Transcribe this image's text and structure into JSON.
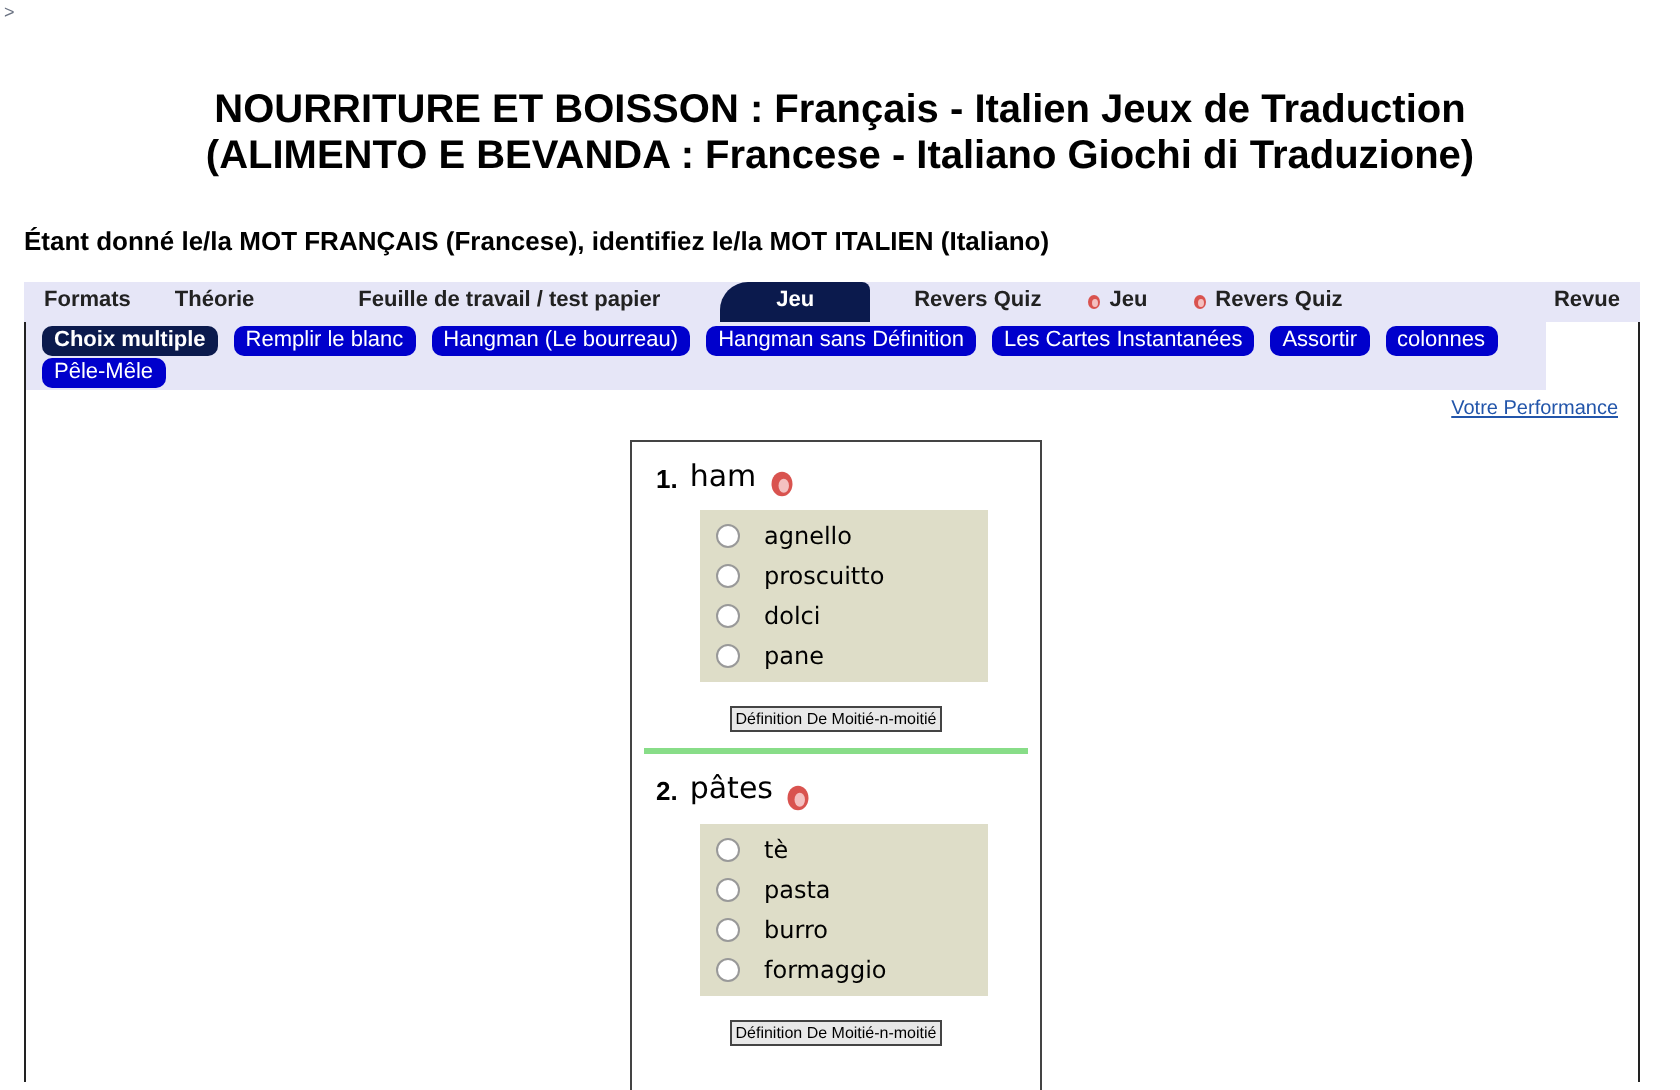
{
  "breadcrumb": ">",
  "title": [
    "NOURRITURE ET BOISSON : Français - Italien Jeux de Traduction",
    "(ALIMENTO E BEVANDA : Francese - Italiano Giochi di Traduzione)"
  ],
  "instruction": "Étant donné le/la MOT FRANÇAIS (Francese), identifiez le/la MOT ITALIEN (Italiano)",
  "tabs": [
    {
      "label": "Formats",
      "selected": false,
      "icon": false
    },
    {
      "label": "Théorie",
      "selected": false,
      "icon": false
    },
    {
      "label": "Feuille de travail / test papier",
      "selected": false,
      "icon": false
    },
    {
      "label": "Jeu",
      "selected": true,
      "icon": false
    },
    {
      "label": "Revers Quiz",
      "selected": false,
      "icon": false
    },
    {
      "label": "Jeu",
      "selected": false,
      "icon": true
    },
    {
      "label": "Revers Quiz",
      "selected": false,
      "icon": true
    },
    {
      "label": "Revue",
      "selected": false,
      "icon": false
    }
  ],
  "game_modes": [
    {
      "label": "Choix multiple",
      "selected": true
    },
    {
      "label": "Remplir le blanc",
      "selected": false
    },
    {
      "label": "Hangman (Le bourreau)",
      "selected": false
    },
    {
      "label": "Hangman sans Définition",
      "selected": false
    },
    {
      "label": "Les Cartes Instantanées",
      "selected": false
    },
    {
      "label": "Assortir",
      "selected": false
    },
    {
      "label": "colonnes",
      "selected": false
    },
    {
      "label": "Pêle-Mêle",
      "selected": false
    }
  ],
  "performance_link": "Votre Performance",
  "questions": [
    {
      "number": "1.",
      "word": "ham",
      "options": [
        {
          "label": "agnello",
          "selected": false
        },
        {
          "label": "proscuitto",
          "selected": false
        },
        {
          "label": "dolci",
          "selected": false
        },
        {
          "label": "pane",
          "selected": false
        }
      ],
      "hint_button": "Définition De Moitié-n-moitié"
    },
    {
      "number": "2.",
      "word": "pâtes",
      "options": [
        {
          "label": "tè",
          "selected": false
        },
        {
          "label": "pasta",
          "selected": false
        },
        {
          "label": "burro",
          "selected": false
        },
        {
          "label": "formaggio",
          "selected": false
        }
      ],
      "hint_button": "Définition De Moitié-n-moitié"
    }
  ]
}
